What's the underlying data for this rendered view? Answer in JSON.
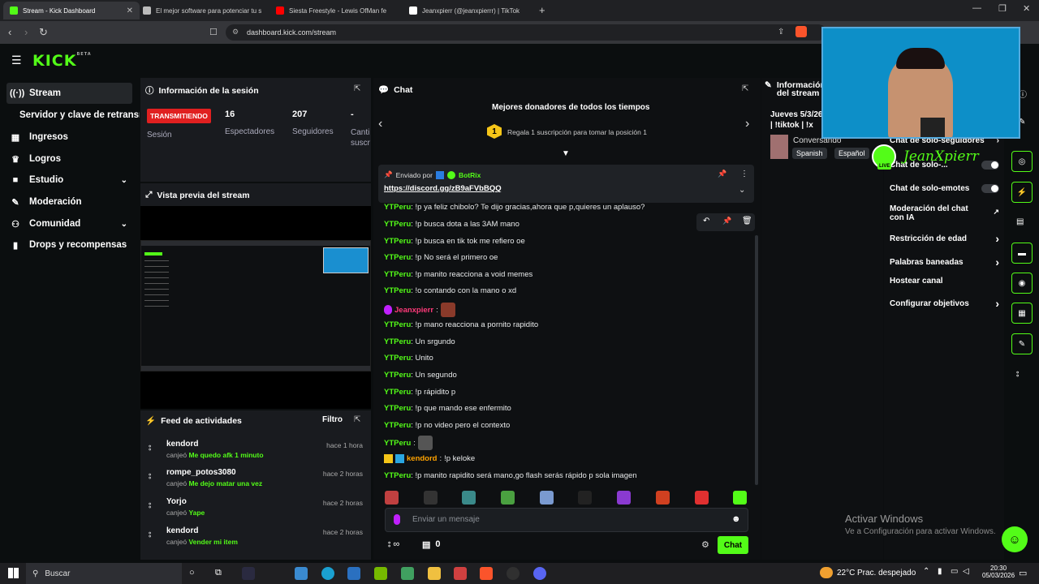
{
  "browser": {
    "tabs": [
      {
        "title": "Stream - Kick Dashboard",
        "color": "#53fc18"
      },
      {
        "title": "El mejor software para potenciar tu s",
        "color": "#bbbbbb"
      },
      {
        "title": "Siesta Freestyle - Lewis OfMan fe",
        "color": "#ff0000"
      },
      {
        "title": "Jeanxpierr (@jeanxpierrr) | TikTok",
        "color": "#ffffff"
      }
    ],
    "url": "dashboard.kick.com/stream"
  },
  "header": {
    "logo": "KICK",
    "logo_tag": "BETA"
  },
  "sidebar": {
    "items": [
      {
        "label": "Stream",
        "icon": "broadcast-icon"
      },
      {
        "label": "Servidor y clave de retransm",
        "icon": ""
      },
      {
        "label": "Ingresos",
        "icon": "dollar-icon"
      },
      {
        "label": "Logros",
        "icon": "trophy-icon"
      },
      {
        "label": "Estudio",
        "icon": "camera-icon"
      },
      {
        "label": "Moderación",
        "icon": "wrench-icon"
      },
      {
        "label": "Comunidad",
        "icon": "people-icon"
      },
      {
        "label": "Drops y recompensas",
        "icon": "chart-icon"
      }
    ]
  },
  "session": {
    "title": "Información de la sesión",
    "badge": "TRANSMITIENDO",
    "sesion_label": "Sesión",
    "stats": [
      {
        "value": "16",
        "label": "Espectadores"
      },
      {
        "value": "207",
        "label": "Seguidores"
      },
      {
        "value": "-",
        "label": "Canti suscr"
      }
    ]
  },
  "preview": {
    "title": "Vista previa del stream"
  },
  "feed": {
    "title": "Feed de actividades",
    "filter": "Filtro",
    "items": [
      {
        "user": "kendord",
        "action": "canjeó",
        "reward": "Me quedo afk 1 minuto",
        "time": "hace 1 hora"
      },
      {
        "user": "rompe_potos3080",
        "action": "canjeó",
        "reward": "Me dejo matar una vez",
        "time": "hace 2 horas"
      },
      {
        "user": "Yorjo",
        "action": "canjeó",
        "reward": "Yape",
        "time": "hace 2 horas"
      },
      {
        "user": "kendord",
        "action": "canjeó",
        "reward": "Vender mi item",
        "time": "hace 2 horas"
      }
    ]
  },
  "chat": {
    "title": "Chat",
    "donors_title": "Mejores donadores de todos los tiempos",
    "donors_rank": "1",
    "donors_text": "Regala 1 suscripción para tomar la posición 1",
    "pinned_by": "Enviado por",
    "pinned_user": "BotRix",
    "pinned_link": "https://discord.gg/zB9aFVbBQQ",
    "messages": [
      {
        "user": "YTPeru",
        "text": "!p ya feliz chibolo? Te dijo gracias,ahora que p,quieres un aplauso?",
        "cls": "u"
      },
      {
        "user": "YTPeru",
        "text": "!p busca dota a las 3AM mano",
        "cls": "u"
      },
      {
        "user": "YTPeru",
        "text": "!p busca en tik tok me refiero oe",
        "cls": "u"
      },
      {
        "user": "YTPeru",
        "text": "!p No será el primero oe",
        "cls": "u"
      },
      {
        "user": "YTPeru",
        "text": "!p manito reacciona a void memes",
        "cls": "u"
      },
      {
        "user": "YTPeru",
        "text": "!o contando con la mano o xd",
        "cls": "u"
      },
      {
        "user": "Jeanxpierr",
        "text": "",
        "cls": "u2"
      },
      {
        "user": "YTPeru",
        "text": "!p mano reacciona a pornito rapidito",
        "cls": "u"
      },
      {
        "user": "YTPeru",
        "text": "Un srgundo",
        "cls": "u"
      },
      {
        "user": "YTPeru",
        "text": "Unito",
        "cls": "u"
      },
      {
        "user": "YTPeru",
        "text": "Un segundo",
        "cls": "u"
      },
      {
        "user": "YTPeru",
        "text": "!p rápidito p",
        "cls": "u"
      },
      {
        "user": "YTPeru",
        "text": "!p que mando ese enfermito",
        "cls": "u"
      },
      {
        "user": "YTPeru",
        "text": "!p no video pero el contexto",
        "cls": "u"
      },
      {
        "user": "YTPeru",
        "text": "",
        "cls": "u"
      },
      {
        "user": "kendord",
        "text": "!p keloke",
        "cls": "u3"
      },
      {
        "user": "YTPeru",
        "text": "!p manito rapidito será mano,go flash serás rápido p sola imagen",
        "cls": "u"
      }
    ],
    "input_placeholder": "Enviar un mensaje",
    "points": "∞",
    "count": "0",
    "send": "Chat"
  },
  "stream_info": {
    "title": "Información del stream",
    "date": "Jueves 5/3/26",
    "tags": "| !tiktok | !x",
    "category": "Conversando",
    "lang1": "Spanish",
    "lang2": "Español"
  },
  "settings": {
    "items": [
      {
        "label": "Chat de solo-seguidores",
        "type": "chevron"
      },
      {
        "label": "Chat de solo-...",
        "type": "toggle"
      },
      {
        "label": "Chat de solo-emotes",
        "type": "toggle"
      },
      {
        "label": "Moderación del chat con IA",
        "type": "external"
      },
      {
        "label": "Restricción de edad",
        "type": "chevron"
      },
      {
        "label": "Palabras baneadas",
        "type": "chevron"
      },
      {
        "label": "Hostear canal",
        "type": "none"
      },
      {
        "label": "Configurar objetivos",
        "type": "chevron"
      }
    ]
  },
  "webcam": {
    "overlay_name": "JeanXpierr",
    "live_tag": "LIVE"
  },
  "windows": {
    "activate_title": "Activar Windows",
    "activate_sub": "Ve a Configuración para activar Windows.",
    "search": "Buscar",
    "weather": "22°C",
    "weather_desc": "Prac. despejado",
    "time": "20:30",
    "date": "05/03/2026"
  },
  "colors": {
    "accent": "#53fc18",
    "live": "#e02020"
  }
}
